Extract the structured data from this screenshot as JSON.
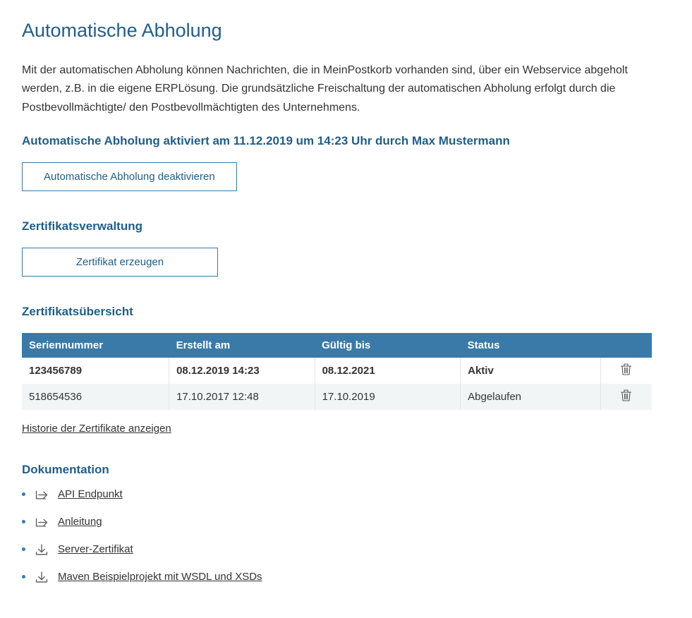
{
  "page": {
    "title": "Automatische Abholung",
    "intro": "Mit der automatischen Abholung können Nachrichten, die in MeinPostkorb vorhanden sind, über ein Webservice abgeholt werden, z.B. in die eigene ERPLösung. Die grundsätzliche Freischaltung der automatischen Abholung erfolgt durch die Postbevollmächtigte/ den Postbevollmächtigten des Unternehmens."
  },
  "activation": {
    "heading": "Automatische Abholung aktiviert am 11.12.2019 um 14:23 Uhr durch Max Mustermann",
    "deactivate_button": "Automatische Abholung deaktivieren"
  },
  "cert_mgmt": {
    "heading": "Zertifikatsverwaltung",
    "create_button": "Zertifikat erzeugen"
  },
  "cert_overview": {
    "heading": "Zertifikatsübersicht",
    "columns": {
      "serial": "Seriennummer",
      "created": "Erstellt am",
      "valid": "Gültig bis",
      "status": "Status"
    },
    "rows": [
      {
        "serial": "123456789",
        "created": "08.12.2019 14:23",
        "valid": "08.12.2021",
        "status": "Aktiv",
        "bold": true
      },
      {
        "serial": "518654536",
        "created": "17.10.2017 12:48",
        "valid": "17.10.2019",
        "status": "Abgelaufen",
        "bold": false
      }
    ],
    "history_link": "Historie der Zertifikate anzeigen"
  },
  "documentation": {
    "heading": "Dokumentation",
    "items": [
      {
        "label": "API Endpunkt",
        "icon": "external"
      },
      {
        "label": "Anleitung",
        "icon": "external"
      },
      {
        "label": "Server-Zertifikat",
        "icon": "download"
      },
      {
        "label": "Maven Beispielprojekt mit WSDL und XSDs",
        "icon": "download"
      }
    ]
  }
}
